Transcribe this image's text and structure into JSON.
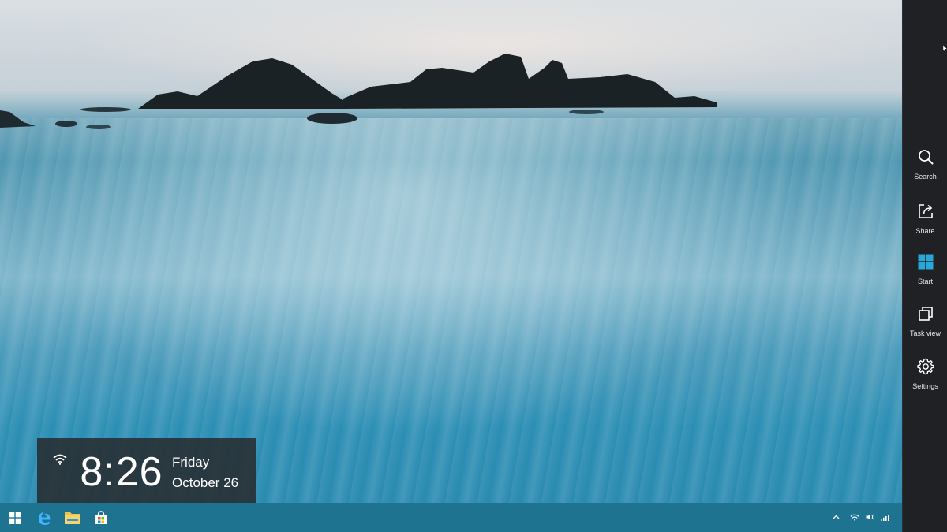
{
  "clock": {
    "time": "8:26",
    "day": "Friday",
    "date": "October 26"
  },
  "charms": {
    "items": [
      {
        "label": "Search",
        "icon": "search-icon"
      },
      {
        "label": "Share",
        "icon": "share-icon"
      },
      {
        "label": "Start",
        "icon": "windows-logo-icon"
      },
      {
        "label": "Task view",
        "icon": "task-view-icon"
      },
      {
        "label": "Settings",
        "icon": "gear-icon"
      }
    ]
  },
  "taskbar": {
    "pinned": [
      {
        "name": "start-button",
        "icon": "windows-logo-icon"
      },
      {
        "name": "edge-button",
        "icon": "edge-icon"
      },
      {
        "name": "file-explorer-button",
        "icon": "folder-icon"
      },
      {
        "name": "store-button",
        "icon": "store-icon"
      }
    ],
    "tray": [
      "chevron-up-icon",
      "wifi-icon",
      "volume-icon",
      "signal-icon"
    ]
  },
  "colors": {
    "taskbar": "#1d7390",
    "charms_bar": "#1f2124",
    "accent": "#2aa7d9"
  }
}
